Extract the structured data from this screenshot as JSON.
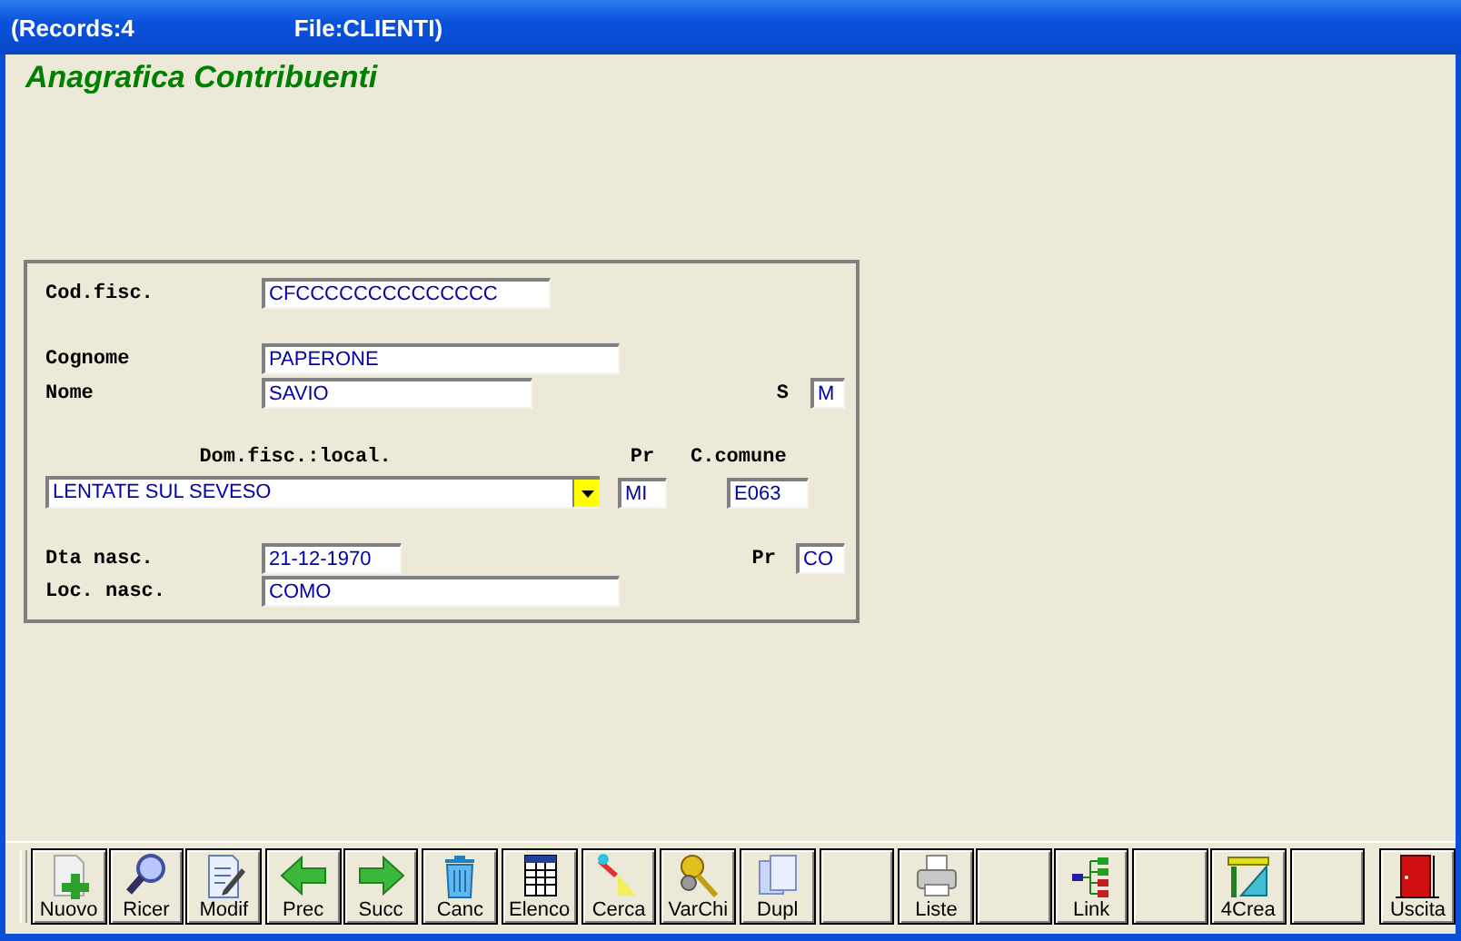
{
  "title_bar": {
    "records": "(Records:4",
    "file": "File:CLIENTI)"
  },
  "heading": "Anagrafica Contribuenti",
  "form": {
    "cod_fisc": {
      "label": "Cod.fisc.",
      "value": "CFCCCCCCCCCCCCCC"
    },
    "cognome": {
      "label": "Cognome",
      "value": "PAPERONE"
    },
    "nome": {
      "label": "Nome",
      "value": "SAVIO"
    },
    "sesso": {
      "label": "S",
      "value": "M"
    },
    "domicilio_header": {
      "localita": "Dom.fisc.:local.",
      "provincia": "Pr",
      "codice_comune": "C.comune"
    },
    "localita": {
      "value": "LENTATE SUL SEVESO"
    },
    "provincia": {
      "value": "MI"
    },
    "codice_comune": {
      "value": "E063"
    },
    "data_nascita": {
      "label": "Dta nasc.",
      "value": "21-12-1970"
    },
    "provincia_nascita": {
      "label": "Pr",
      "value": "CO"
    },
    "luogo_nascita": {
      "label": "Loc. nasc.",
      "value": "COMO"
    }
  },
  "toolbar": [
    {
      "kind": "new",
      "label": "Nuovo"
    },
    {
      "kind": "search",
      "label": "Ricer"
    },
    {
      "kind": "edit",
      "label": "Modif"
    },
    {
      "kind": "prev",
      "label": "Prec"
    },
    {
      "kind": "next",
      "label": "Succ"
    },
    {
      "kind": "delete",
      "label": "Canc"
    },
    {
      "kind": "list",
      "label": "Elenco"
    },
    {
      "kind": "find",
      "label": "Cerca"
    },
    {
      "kind": "keys",
      "label": "VarChi"
    },
    {
      "kind": "copy",
      "label": "Dupl"
    },
    {
      "kind": "blank"
    },
    {
      "kind": "print",
      "label": "Liste"
    },
    {
      "kind": "blank"
    },
    {
      "kind": "link",
      "label": "Link"
    },
    {
      "kind": "blank"
    },
    {
      "kind": "create",
      "label": "4Crea"
    },
    {
      "kind": "blank"
    },
    {
      "kind": "exit",
      "label": "Uscita"
    }
  ]
}
